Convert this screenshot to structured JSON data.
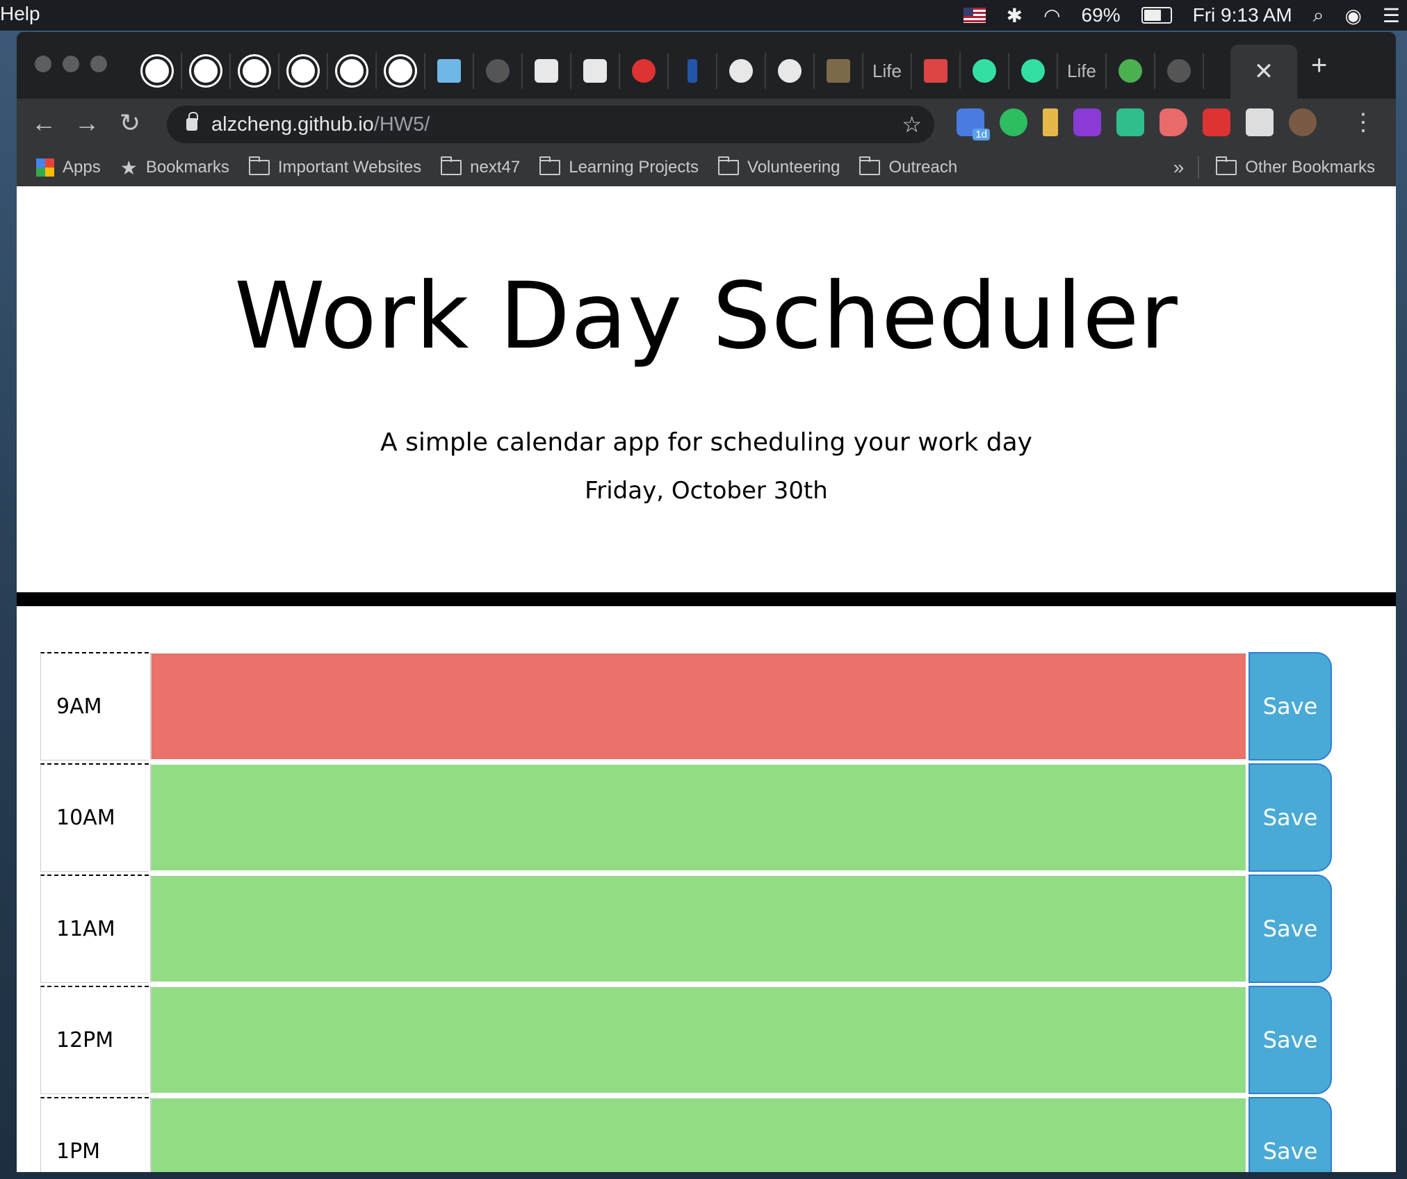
{
  "menubar": {
    "app_menu": "Help",
    "battery": "69%",
    "clock": "Fri 9:13 AM"
  },
  "browser": {
    "tab_labels": [
      "Life",
      "Life"
    ],
    "url_host": "alzcheng.github.io",
    "url_path": "/HW5/",
    "bookmarks": [
      "Apps",
      "Bookmarks",
      "Important Websites",
      "next47",
      "Learning Projects",
      "Volunteering",
      "Outreach"
    ],
    "overflow": "»",
    "other_bookmarks": "Other Bookmarks",
    "calendar_badge": "1d"
  },
  "header": {
    "title": "Work Day Scheduler",
    "lead": "A simple calendar app for scheduling your work day",
    "current_day": "Friday, October 30th"
  },
  "schedule": {
    "save_label": "Save",
    "rows": [
      {
        "hour": "9AM",
        "state": "past"
      },
      {
        "hour": "10AM",
        "state": "future"
      },
      {
        "hour": "11AM",
        "state": "future"
      },
      {
        "hour": "12PM",
        "state": "future"
      },
      {
        "hour": "1PM",
        "state": "future"
      }
    ]
  },
  "colors": {
    "past": "#e9726a",
    "future": "#92dc86",
    "save": "#4aaad6"
  }
}
